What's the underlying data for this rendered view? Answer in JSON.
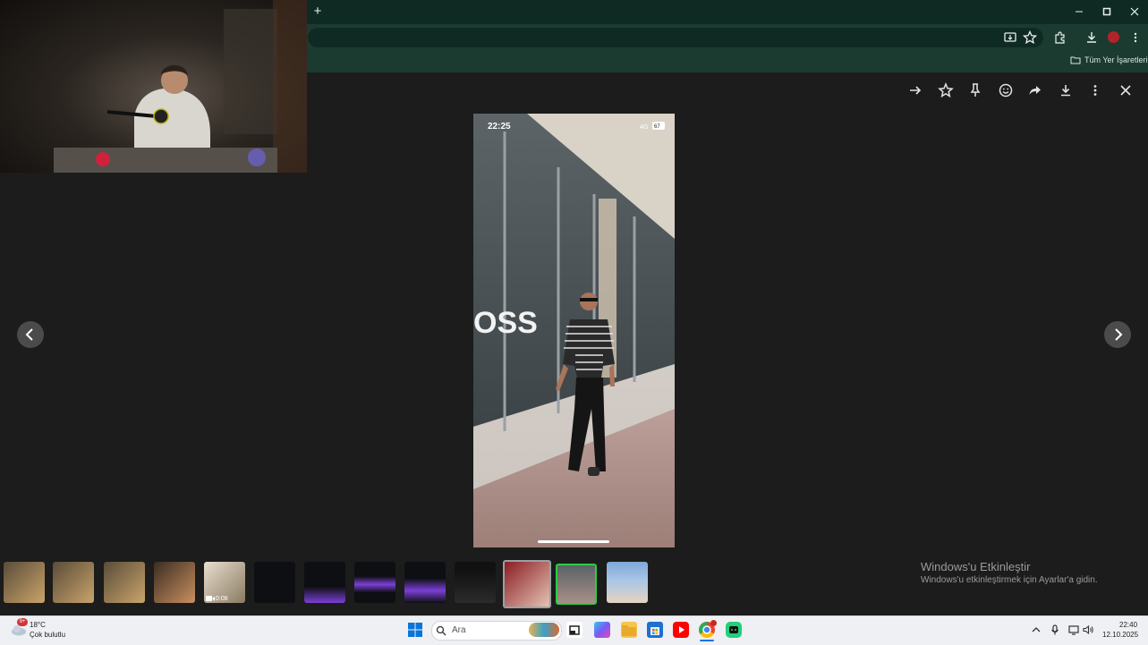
{
  "browser": {
    "new_tab_label": "+",
    "bookmark_folder_label": "Tüm Yer İşaretleri",
    "window_controls": [
      "minimize-icon",
      "restore-icon",
      "close-icon"
    ]
  },
  "viewer": {
    "photo_status_time": "22:25",
    "photo_status_signal": "4G",
    "photo_status_battery": "67",
    "photo_storefront_text": "OSS",
    "actions": [
      "arrow-right-icon",
      "star-icon",
      "pin-icon",
      "emoji-icon",
      "share-icon",
      "download-icon",
      "more-vert-icon",
      "close-icon"
    ],
    "video_duration": "0:08"
  },
  "activation": {
    "title": "Windows'u Etkinleştir",
    "subtitle": "Windows'u etkinleştirmek için Ayarlar'a gidin."
  },
  "taskbar": {
    "weather_temp": "18°C",
    "weather_desc": "Çok bulutlu",
    "weather_badge": "9+",
    "search_placeholder": "Ara",
    "clock_time": "22:40",
    "clock_date": "12.10.2025"
  },
  "colors": {
    "selected_thumb_border": "#9aa0a6",
    "active_thumb_border": "#2ecc40",
    "chrome_dark": "#0f2a22",
    "chrome_toolbar": "#1b3b31"
  }
}
